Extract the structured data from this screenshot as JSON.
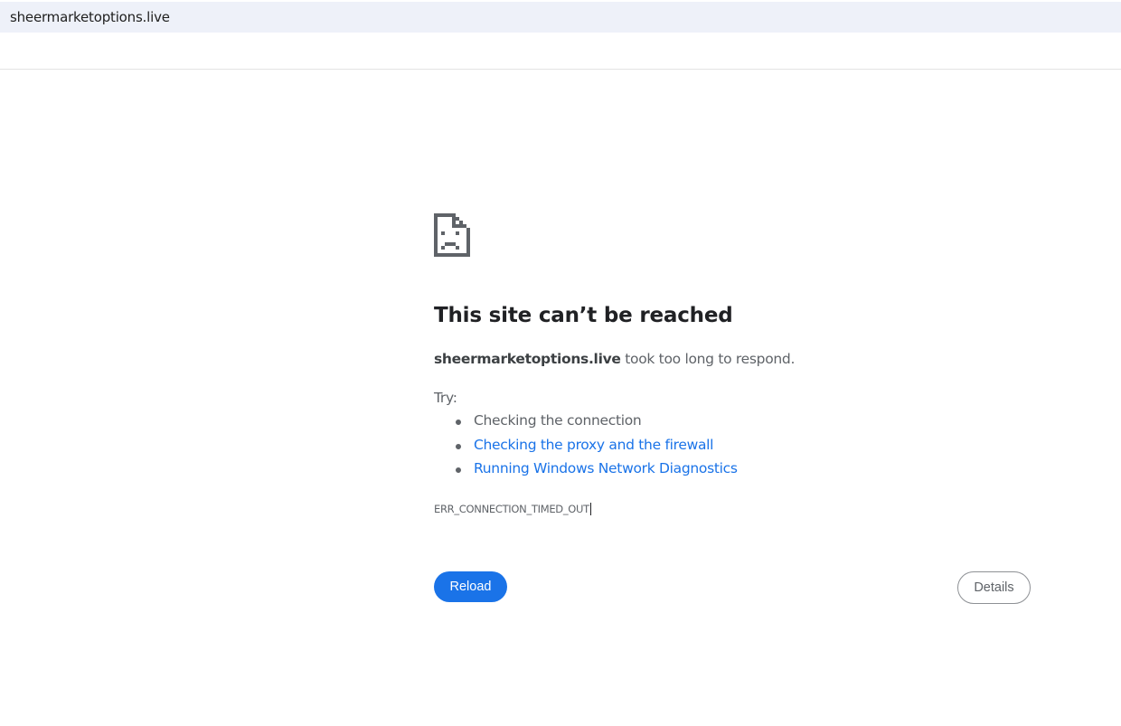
{
  "address_bar": {
    "url": "sheermarketoptions.live"
  },
  "error_page": {
    "icon": "sad-page-icon",
    "headline": "This site can’t be reached",
    "summary_host": "sheermarketoptions.live",
    "summary_rest": " took too long to respond.",
    "try_label": "Try:",
    "suggestions": [
      {
        "label": "Checking the connection",
        "is_link": false
      },
      {
        "label": "Checking the proxy and the firewall",
        "is_link": true
      },
      {
        "label": "Running Windows Network Diagnostics",
        "is_link": true
      }
    ],
    "error_code": "ERR_CONNECTION_TIMED_OUT",
    "reload_label": "Reload",
    "details_label": "Details"
  },
  "colors": {
    "address_bar_bg": "#eef1f9",
    "link": "#1a73e8",
    "primary_button": "#1a73e8",
    "text_secondary": "#5f6368",
    "headline": "#202124"
  }
}
